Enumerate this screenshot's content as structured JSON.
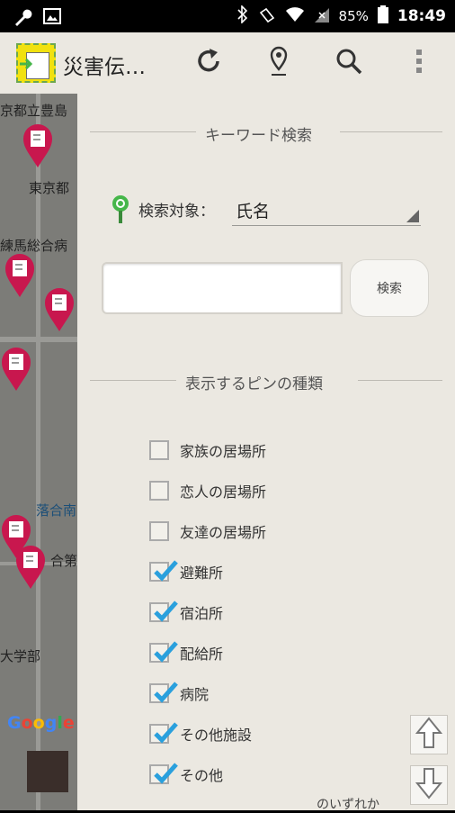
{
  "status": {
    "battery": "85%",
    "time": "18:49"
  },
  "toolbar": {
    "title": "災害伝…"
  },
  "map": {
    "labels": [
      "京都立豊島",
      "東京都",
      "練馬総合病",
      "落合南",
      "合第",
      "大学部"
    ],
    "attribution": "Google"
  },
  "keyword_section": {
    "header": "キーワード検索",
    "target_label": "検索対象：",
    "target_value": "氏名",
    "input_value": "",
    "search_button": "検索"
  },
  "pin_section": {
    "header": "表示するピンの種類",
    "items": [
      {
        "label": "家族の居場所",
        "checked": false
      },
      {
        "label": "恋人の居場所",
        "checked": false
      },
      {
        "label": "友達の居場所",
        "checked": false
      },
      {
        "label": "避難所",
        "checked": true
      },
      {
        "label": "宿泊所",
        "checked": true
      },
      {
        "label": "配給所",
        "checked": true
      },
      {
        "label": "病院",
        "checked": true
      },
      {
        "label": "その他施設",
        "checked": true
      },
      {
        "label": "その他",
        "checked": true
      }
    ],
    "footer_note": "のいずれか"
  },
  "colors": {
    "pin": "#c8174e",
    "check": "#2aa0dd",
    "panel": "#ebe8e1",
    "accent_green": "#45b649"
  }
}
